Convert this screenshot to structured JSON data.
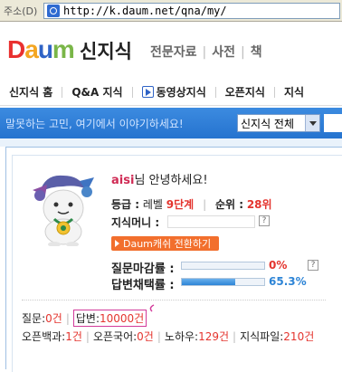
{
  "browser": {
    "address_label": "주소(D)",
    "url": "http://k.daum.net/qna/my/"
  },
  "header": {
    "logo": "Daum",
    "service": "신지식",
    "links": [
      "전문자료",
      "사전",
      "책"
    ]
  },
  "nav": {
    "items": [
      "신지식 홈",
      "Q&A 지식",
      "동영상지식",
      "오픈지식",
      "지식"
    ]
  },
  "search": {
    "placeholder": "말못하는 고민, 여기에서 이야기하세요!",
    "scope": "신지식 전체"
  },
  "profile": {
    "user_id": "aisi",
    "greeting_suffix": "님 안녕하세요!",
    "grade_label": "등급 :",
    "grade_prefix": "레벨 ",
    "grade_value": "9단계",
    "rank_label": "순위 :",
    "rank_value": "28위",
    "money_label": "지식머니 :",
    "cash_button": "Daum캐쉬 전환하기",
    "question_close_label": "질문마감률 :",
    "question_close_pct": "0%",
    "question_close_value": 0,
    "answer_adopt_label": "답변채택률 :",
    "answer_adopt_pct": "65.3%",
    "answer_adopt_value": 65.3,
    "help_mark": "?"
  },
  "stats": {
    "question_label": "질문:",
    "question_count": "0건",
    "answer_label": "답변:",
    "answer_count": "10000건",
    "open_wiki_label": "오픈백과:",
    "open_wiki_count": "1건",
    "open_dict_label": "오픈국어:",
    "open_dict_count": "0건",
    "knowhow_label": "노하우:",
    "knowhow_count": "129건",
    "file_label": "지식파일:",
    "file_count": "210건"
  },
  "colors": {
    "accent_red": "#e4342e",
    "search_blue": "#2573cf",
    "cash_orange": "#f26f2d",
    "id_pink": "#d02b55"
  }
}
